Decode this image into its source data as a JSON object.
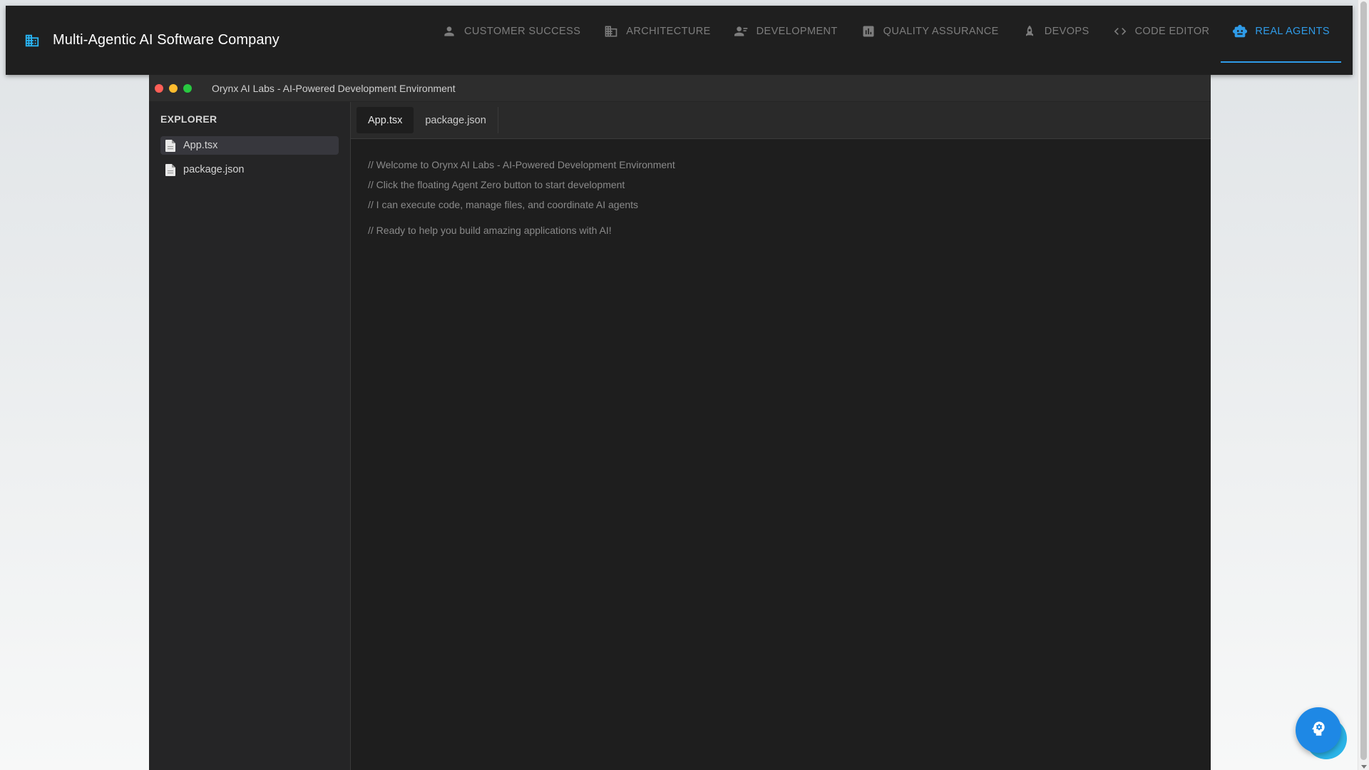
{
  "appbar": {
    "title": "Multi-Agentic AI Software Company",
    "brand_icon": "building-icon",
    "tabs": [
      {
        "label": "Customer Success",
        "icon": "person-icon",
        "active": false
      },
      {
        "label": "Architecture",
        "icon": "apartment-icon",
        "active": false
      },
      {
        "label": "Development",
        "icon": "developer-icon",
        "active": false
      },
      {
        "label": "Quality Assurance",
        "icon": "chart-icon",
        "active": false
      },
      {
        "label": "DevOps",
        "icon": "rocket-icon",
        "active": false
      },
      {
        "label": "Code Editor",
        "icon": "code-icon",
        "active": false
      },
      {
        "label": "Real Agents",
        "icon": "robot-icon",
        "active": true
      }
    ],
    "accent_color": "#2f9be8"
  },
  "window": {
    "title": "Orynx AI Labs - AI-Powered Development Environment"
  },
  "sidebar": {
    "title": "EXPLORER",
    "files": [
      {
        "name": "App.tsx",
        "selected": true
      },
      {
        "name": "package.json",
        "selected": false
      }
    ]
  },
  "editor": {
    "tabs": [
      {
        "label": "App.tsx",
        "active": true
      },
      {
        "label": "package.json",
        "active": false
      }
    ],
    "lines": [
      "// Welcome to Orynx AI Labs - AI-Powered Development Environment",
      "// Click the floating Agent Zero button to start development",
      "// I can execute code, manage files, and coordinate AI agents",
      "// Ready to help you build amazing applications with AI!"
    ]
  },
  "fab": {
    "icon": "psychology-icon",
    "color": "#1e88e5"
  }
}
